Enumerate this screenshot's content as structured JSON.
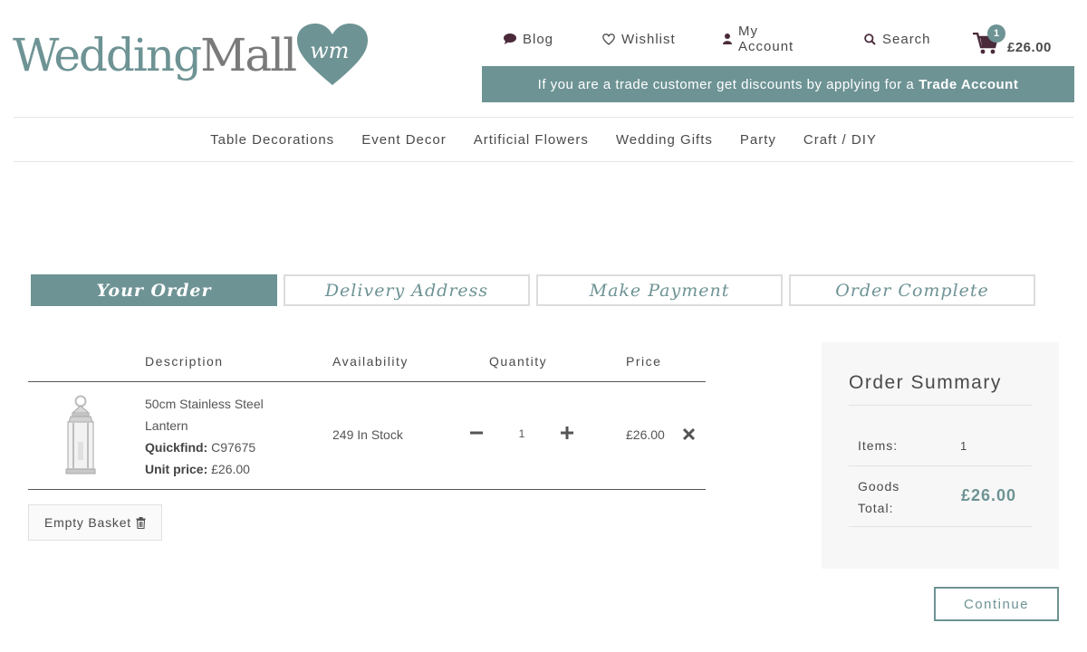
{
  "brand": {
    "name_part1": "Wedding",
    "name_part2": "Mall",
    "heart_text": "wm"
  },
  "topnav": {
    "blog": "Blog",
    "wishlist": "Wishlist",
    "account": "My Account",
    "search": "Search"
  },
  "cart": {
    "count": "1",
    "total": "£26.00"
  },
  "trade_banner": {
    "text": "If you are a trade customer get discounts by applying for a",
    "link": "Trade Account"
  },
  "mainnav": [
    "Table Decorations",
    "Event Decor",
    "Artificial Flowers",
    "Wedding Gifts",
    "Party",
    "Craft / DIY"
  ],
  "steps": [
    "Your Order",
    "Delivery Address",
    "Make Payment",
    "Order Complete"
  ],
  "table": {
    "headers": {
      "description": "Description",
      "availability": "Availability",
      "quantity": "Quantity",
      "price": "Price"
    },
    "rows": [
      {
        "name_line1": "50cm Stainless Steel",
        "name_line2": "Lantern",
        "quickfind_label": "Quickfind:",
        "quickfind": "C97675",
        "unit_price_label": "Unit price:",
        "unit_price": "£26.00",
        "availability": "249 In Stock",
        "quantity": "1",
        "price": "£26.00"
      }
    ]
  },
  "empty_basket": "Empty Basket",
  "summary": {
    "title": "Order Summary",
    "items_label": "Items:",
    "items_value": "1",
    "goods_label": "Goods Total:",
    "goods_value": "£26.00"
  },
  "continue": "Continue",
  "colors": {
    "accent": "#6e9394",
    "text": "#4a4a4a"
  }
}
